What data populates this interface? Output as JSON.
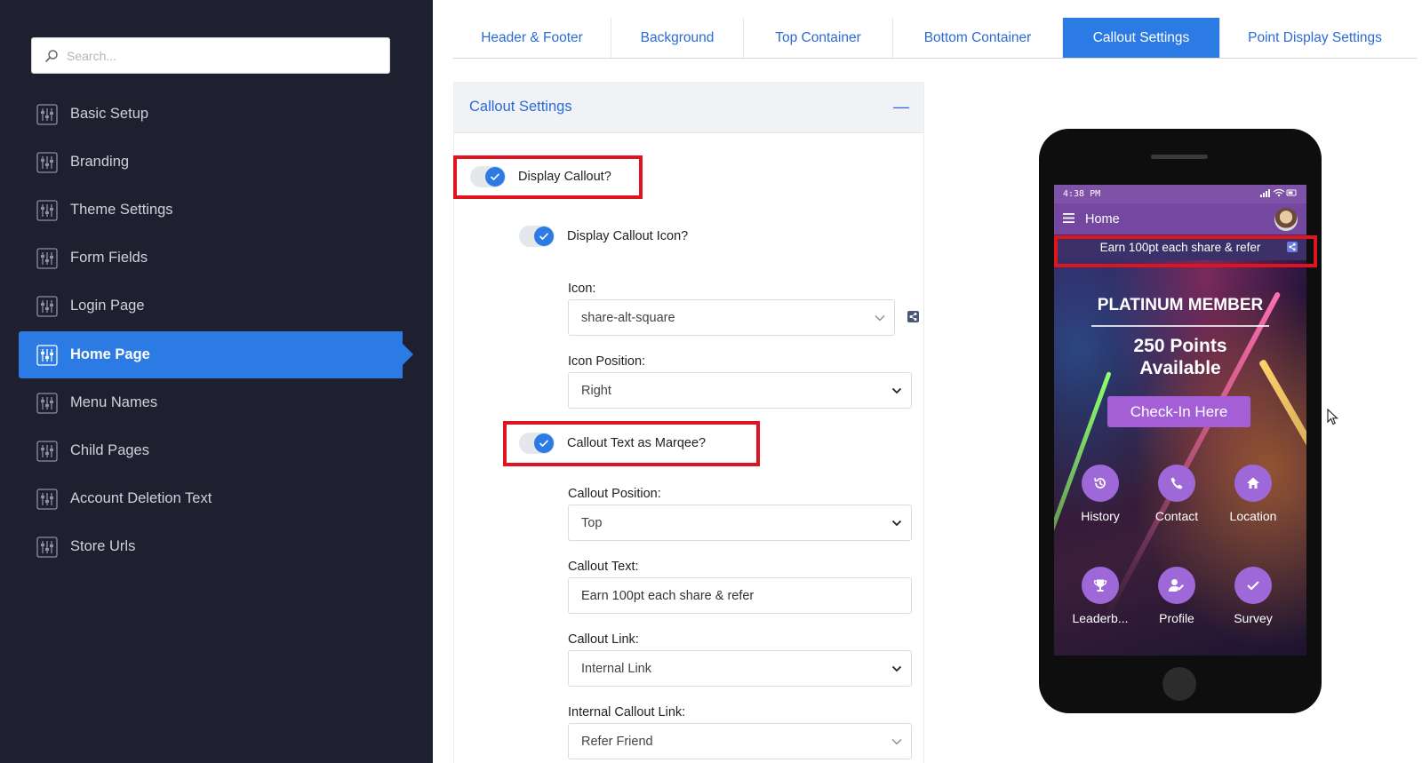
{
  "search": {
    "placeholder": "Search..."
  },
  "sidebar": {
    "items": [
      {
        "label": "Basic Setup"
      },
      {
        "label": "Branding"
      },
      {
        "label": "Theme Settings"
      },
      {
        "label": "Form Fields"
      },
      {
        "label": "Login Page"
      },
      {
        "label": "Home Page"
      },
      {
        "label": "Menu Names"
      },
      {
        "label": "Child Pages"
      },
      {
        "label": "Account Deletion Text"
      },
      {
        "label": "Store Urls"
      }
    ]
  },
  "tabs": [
    {
      "label": "Header & Footer"
    },
    {
      "label": "Background"
    },
    {
      "label": "Top Container"
    },
    {
      "label": "Bottom Container"
    },
    {
      "label": "Callout Settings"
    },
    {
      "label": "Point Display Settings"
    }
  ],
  "panel": {
    "title": "Callout Settings",
    "collapse_symbol": "—",
    "display_callout": "Display Callout?",
    "display_callout_icon": "Display Callout Icon?",
    "icon_label": "Icon:",
    "icon_value": "share-alt-square",
    "icon_position_label": "Icon Position:",
    "icon_position_value": "Right",
    "marquee_label": "Callout Text as Marqee?",
    "callout_position_label": "Callout Position:",
    "callout_position_value": "Top",
    "callout_text_label": "Callout Text:",
    "callout_text_value": "Earn 100pt each share & refer",
    "callout_link_label": "Callout Link:",
    "callout_link_value": "Internal Link",
    "internal_link_label": "Internal Callout Link:",
    "internal_link_value": "Refer Friend"
  },
  "phone": {
    "time": "4:38 PM",
    "page_title": "Home",
    "callout_text": "Earn 100pt each share & refer",
    "tier": "PLATINUM MEMBER",
    "points_line1": "250 Points",
    "points_line2": "Available",
    "checkin": "Check-In Here",
    "actions": [
      {
        "label": "History",
        "icon": "history-icon"
      },
      {
        "label": "Contact",
        "icon": "phone-icon"
      },
      {
        "label": "Location",
        "icon": "home-icon"
      },
      {
        "label": "Leaderb...",
        "icon": "trophy-icon"
      },
      {
        "label": "Profile",
        "icon": "user-edit-icon"
      },
      {
        "label": "Survey",
        "icon": "check-icon"
      }
    ]
  },
  "colors": {
    "sidebar_bg": "#1e1f2f",
    "accent": "#2c7be5",
    "highlight": "#e0141e",
    "phone_header": "#7447a0"
  }
}
